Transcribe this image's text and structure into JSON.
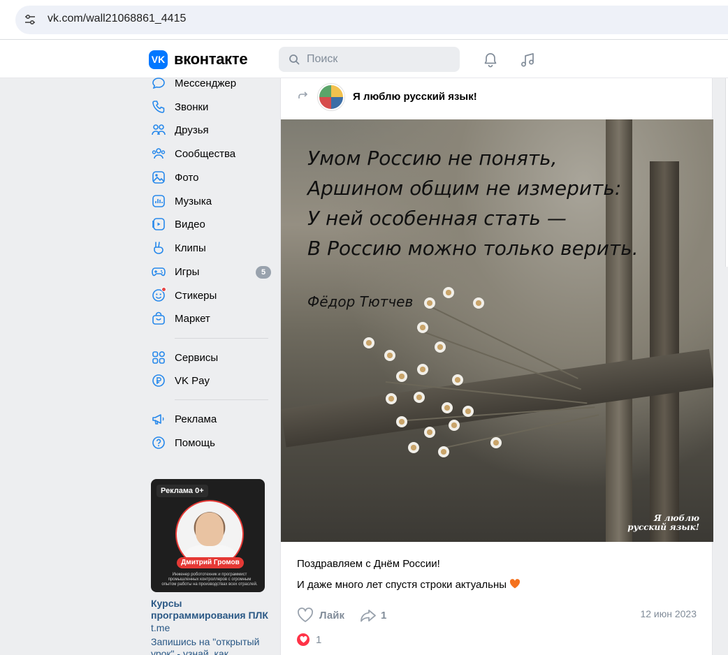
{
  "browser": {
    "url": "vk.com/wall21068861_4415"
  },
  "header": {
    "logo_mark": "VK",
    "logo_text": "вконтакте",
    "search_placeholder": "Поиск"
  },
  "sidebar": {
    "items": [
      {
        "label": "Мессенджер",
        "icon": "chat-icon"
      },
      {
        "label": "Звонки",
        "icon": "phone-icon"
      },
      {
        "label": "Друзья",
        "icon": "friends-icon"
      },
      {
        "label": "Сообщества",
        "icon": "communities-icon"
      },
      {
        "label": "Фото",
        "icon": "photo-icon"
      },
      {
        "label": "Музыка",
        "icon": "music-icon"
      },
      {
        "label": "Видео",
        "icon": "video-icon"
      },
      {
        "label": "Клипы",
        "icon": "clips-icon"
      },
      {
        "label": "Игры",
        "icon": "gamepad-icon",
        "badge": "5"
      },
      {
        "label": "Стикеры",
        "icon": "sticker-icon"
      },
      {
        "label": "Маркет",
        "icon": "market-bag-icon"
      },
      {
        "label": "Сервисы",
        "icon": "services-grid-icon"
      },
      {
        "label": "VK Pay",
        "icon": "ruble-icon"
      },
      {
        "label": "Реклама",
        "icon": "megaphone-icon"
      },
      {
        "label": "Помощь",
        "icon": "help-icon"
      }
    ]
  },
  "ad": {
    "label": "Реклама 0+",
    "person_name": "Дмитрий Громов",
    "description": "Инженер робототехник и программист промышленных контроллеров с огромным опытом работы на производствах всех отраслей.",
    "title": "Курсы программирования ПЛК",
    "domain": "t.me",
    "text": "Запишись на \"открытый урок\" - узнай, как"
  },
  "post": {
    "group_name": "Я люблю русский язык!",
    "poem_lines": [
      "Умом Россию не понять,",
      "Аршином общим не измерить:",
      "У ней особенная стать —",
      "В Россию можно только верить."
    ],
    "poem_author": "Фёдор Тютчев",
    "watermark_line1": "Я люблю",
    "watermark_line2": "русский язык!",
    "text_line1": "Поздравляем с Днём России!",
    "text_line2": "И даже много лет спустя строки актуальны",
    "like_label": "Лайк",
    "share_count": "1",
    "date": "12 июн 2023",
    "reaction_count": "1"
  },
  "colors": {
    "accent": "#0077ff",
    "link": "#2a5885",
    "secondary_text": "#818c99",
    "reaction": "#ff3347"
  }
}
